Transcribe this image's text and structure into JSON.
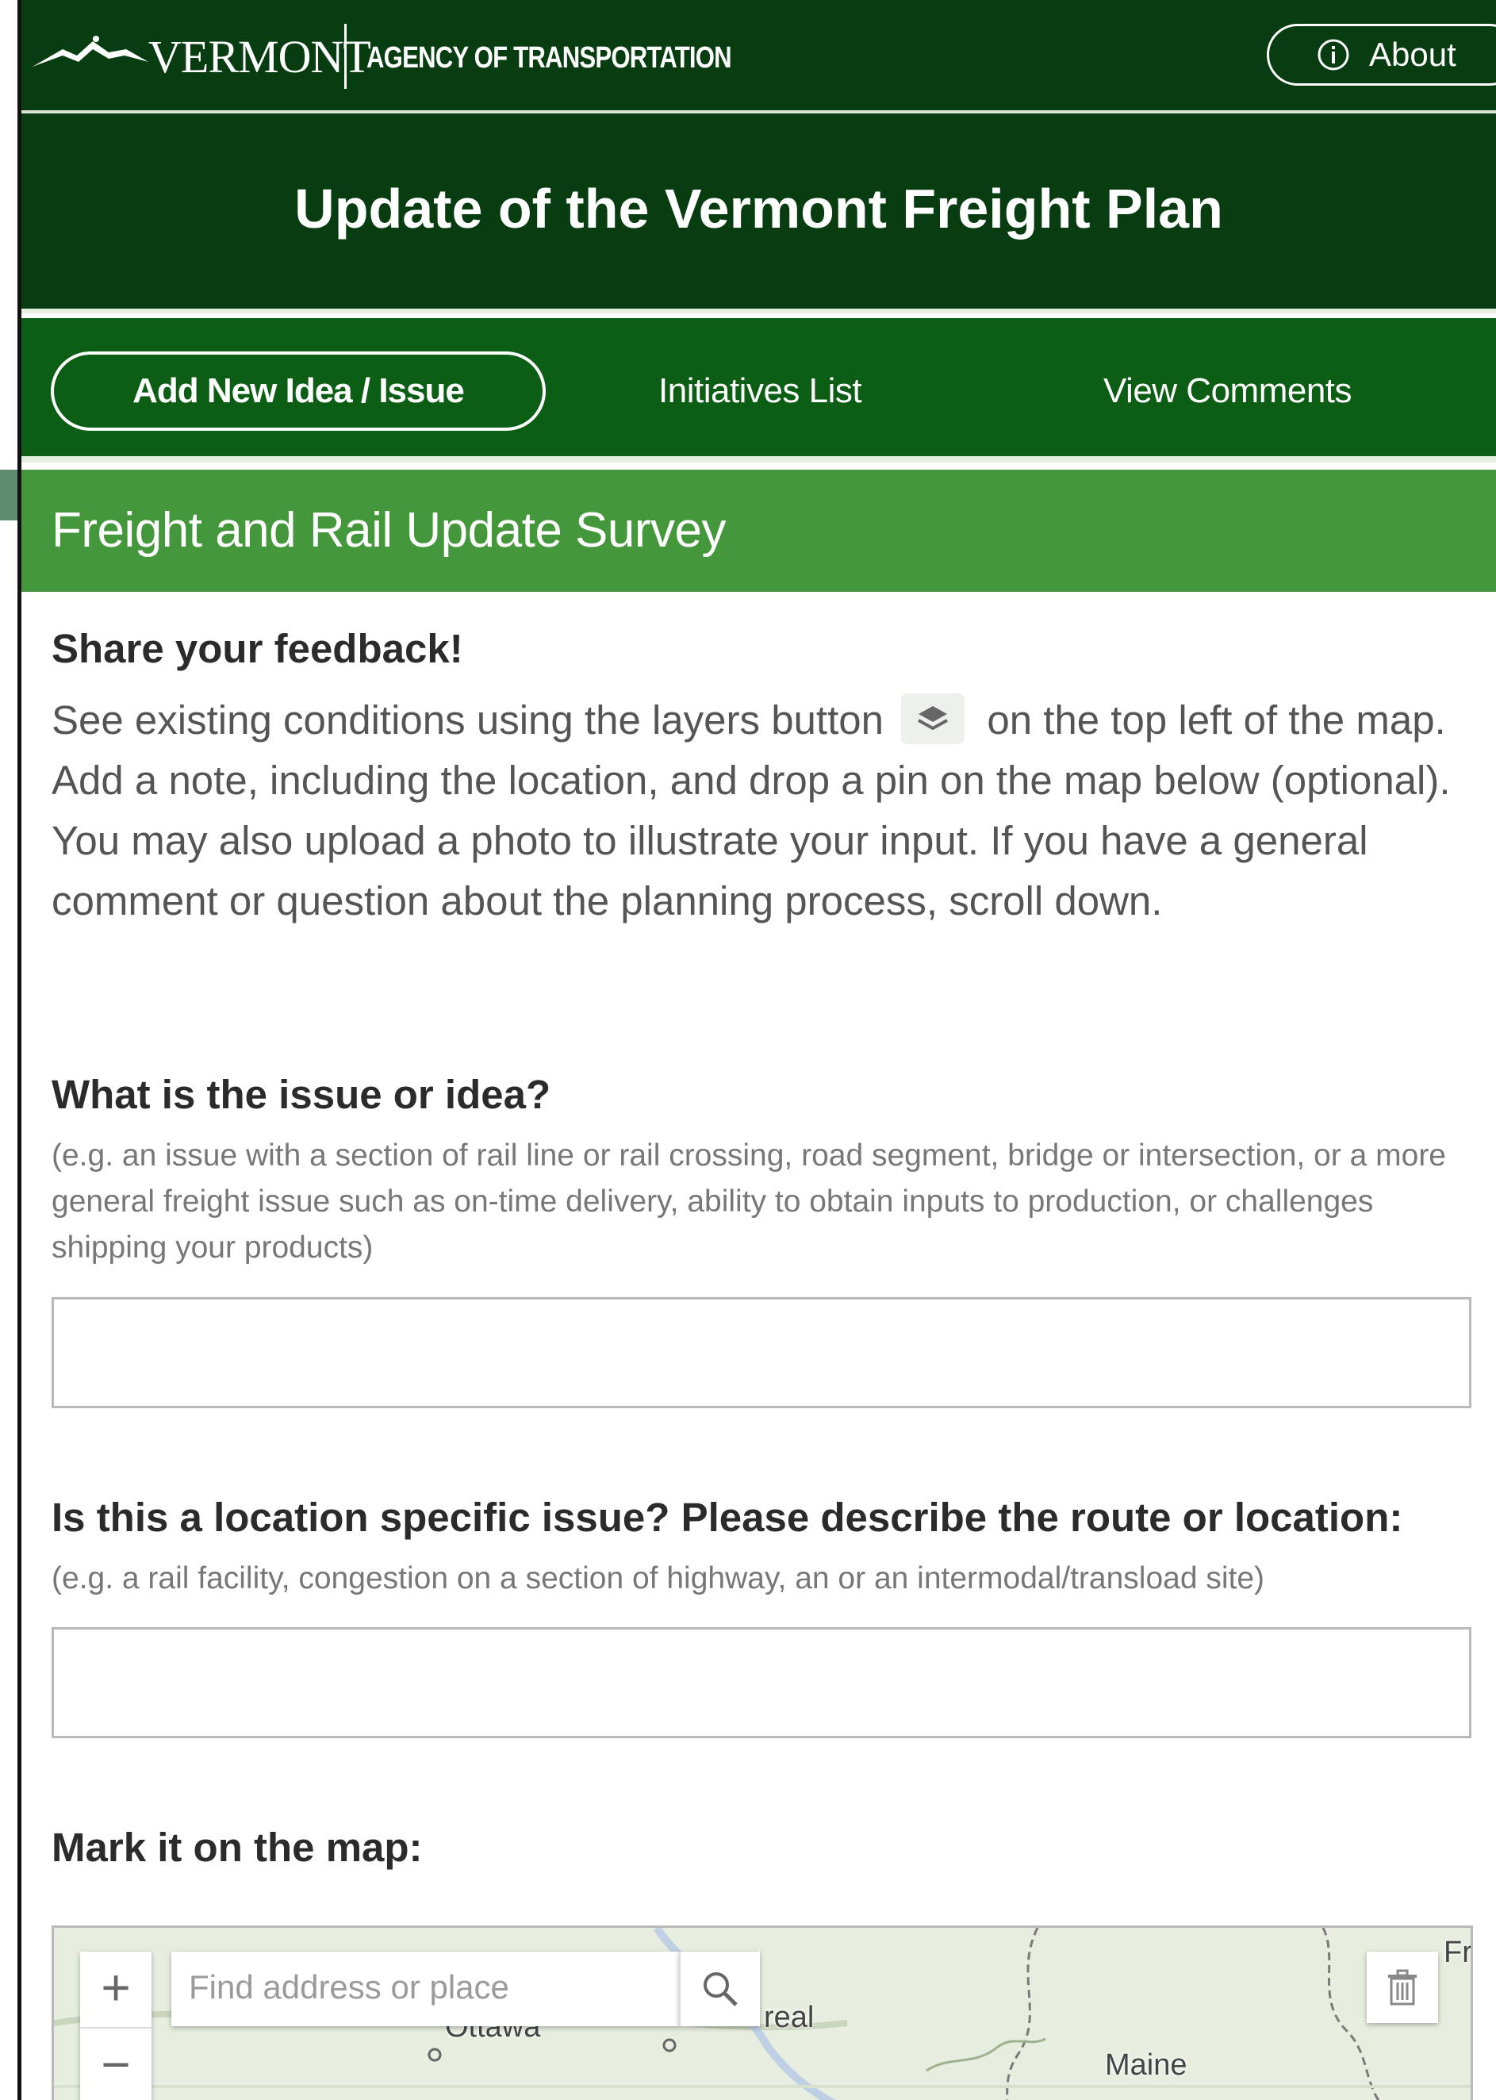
{
  "header": {
    "state_name": "VERMONT",
    "agency_name": "AGENCY OF TRANSPORTATION",
    "about_label": "About"
  },
  "title": "Update of the Vermont Freight Plan",
  "nav": {
    "primary_label": "Add New Idea / Issue",
    "initiatives_label": "Initiatives List",
    "comments_label": "View Comments"
  },
  "survey": {
    "heading": "Freight and Rail Update Survey",
    "intro_heading": "Share your feedback!",
    "intro_before_icon": "See existing conditions using the layers button",
    "intro_after_icon": "on the top left of the map. Add a note, including the location, and drop a pin on the map below (optional). You may also upload a photo to illustrate your input. If you have a general comment or question about the planning process, scroll down.",
    "q1_label": "What is the issue or idea?",
    "q1_help": "(e.g. an issue with a section of rail line or rail crossing, road segment, bridge or intersection, or a more general freight issue such as on-time delivery, ability to obtain inputs to production, or challenges shipping your products)",
    "q1_value": "",
    "q2_label": "Is this a location specific issue? Please describe the route or location:",
    "q2_help": "(e.g. a rail facility, congestion on a section of highway, an or an intermodal/transload site)",
    "q2_value": "",
    "map_label": "Mark it on the map:"
  },
  "map": {
    "search_placeholder": "Find address or place",
    "zoom_in_symbol": "+",
    "zoom_out_symbol": "−",
    "place_labels": {
      "ottawa": "Ottawa",
      "montreal": "real",
      "maine": "Maine",
      "corner": "Fr"
    }
  },
  "icons": {
    "logo": "vermont-mountain-logo",
    "about": "info-circle-icon",
    "layers": "layers-icon",
    "search": "search-icon",
    "trash": "trash-icon"
  },
  "colors": {
    "dark_green": "#073d10",
    "nav_green": "#0b5e13",
    "survey_green": "#45973c"
  }
}
